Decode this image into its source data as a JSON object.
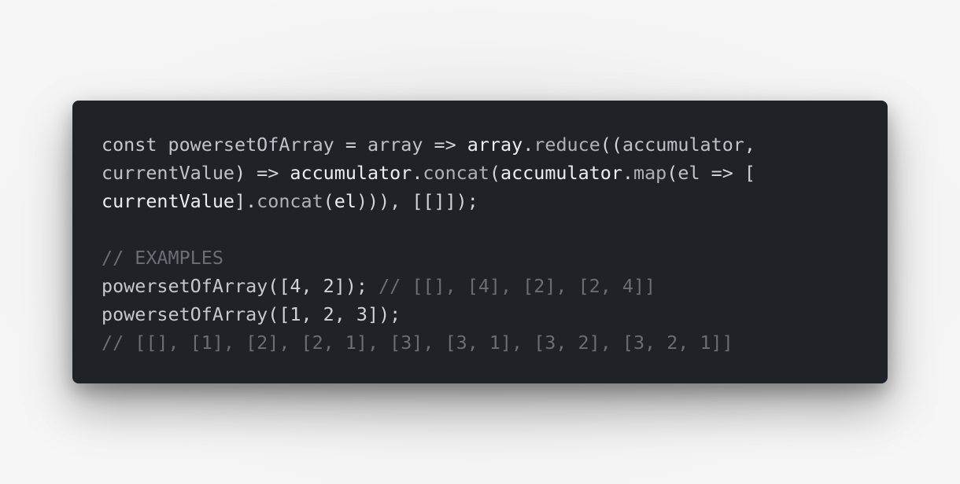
{
  "code": {
    "lines": [
      [
        {
          "t": "const ",
          "c": "kw"
        },
        {
          "t": "powersetOfArray",
          "c": "ident"
        },
        {
          "t": " = ",
          "c": "punct"
        },
        {
          "t": "array",
          "c": "ident"
        },
        {
          "t": " => ",
          "c": "punct"
        },
        {
          "t": "array",
          "c": "ident-bright"
        },
        {
          "t": ".",
          "c": "punct"
        },
        {
          "t": "reduce",
          "c": "method"
        },
        {
          "t": "((",
          "c": "punct"
        },
        {
          "t": "accumulator",
          "c": "ident"
        },
        {
          "t": ",",
          "c": "punct"
        }
      ],
      [
        {
          "t": "currentValue",
          "c": "ident"
        },
        {
          "t": ") => ",
          "c": "punct"
        },
        {
          "t": "accumulator",
          "c": "ident-bright"
        },
        {
          "t": ".",
          "c": "punct"
        },
        {
          "t": "concat",
          "c": "method"
        },
        {
          "t": "(",
          "c": "punct"
        },
        {
          "t": "accumulator",
          "c": "ident-bright"
        },
        {
          "t": ".",
          "c": "punct"
        },
        {
          "t": "map",
          "c": "method"
        },
        {
          "t": "(",
          "c": "punct"
        },
        {
          "t": "el",
          "c": "ident"
        },
        {
          "t": " => [",
          "c": "punct"
        }
      ],
      [
        {
          "t": "currentValue",
          "c": "ident-bright"
        },
        {
          "t": "].",
          "c": "punct"
        },
        {
          "t": "concat",
          "c": "method"
        },
        {
          "t": "(",
          "c": "punct"
        },
        {
          "t": "el",
          "c": "ident-bright"
        },
        {
          "t": "))), [[]]);",
          "c": "punct"
        }
      ],
      [],
      [
        {
          "t": "// EXAMPLES",
          "c": "comment"
        }
      ],
      [
        {
          "t": "powersetOfArray",
          "c": "call"
        },
        {
          "t": "([4, 2]);",
          "c": "punct"
        },
        {
          "t": " // [[], [4], [2], [2, 4]]",
          "c": "comment"
        }
      ],
      [
        {
          "t": "powersetOfArray",
          "c": "call"
        },
        {
          "t": "([1, 2, 3]);",
          "c": "punct"
        }
      ],
      [
        {
          "t": "// [[], [1], [2], [2, 1], [3], [3, 1], [3, 2], [3, 2, 1]]",
          "c": "comment"
        }
      ]
    ]
  }
}
